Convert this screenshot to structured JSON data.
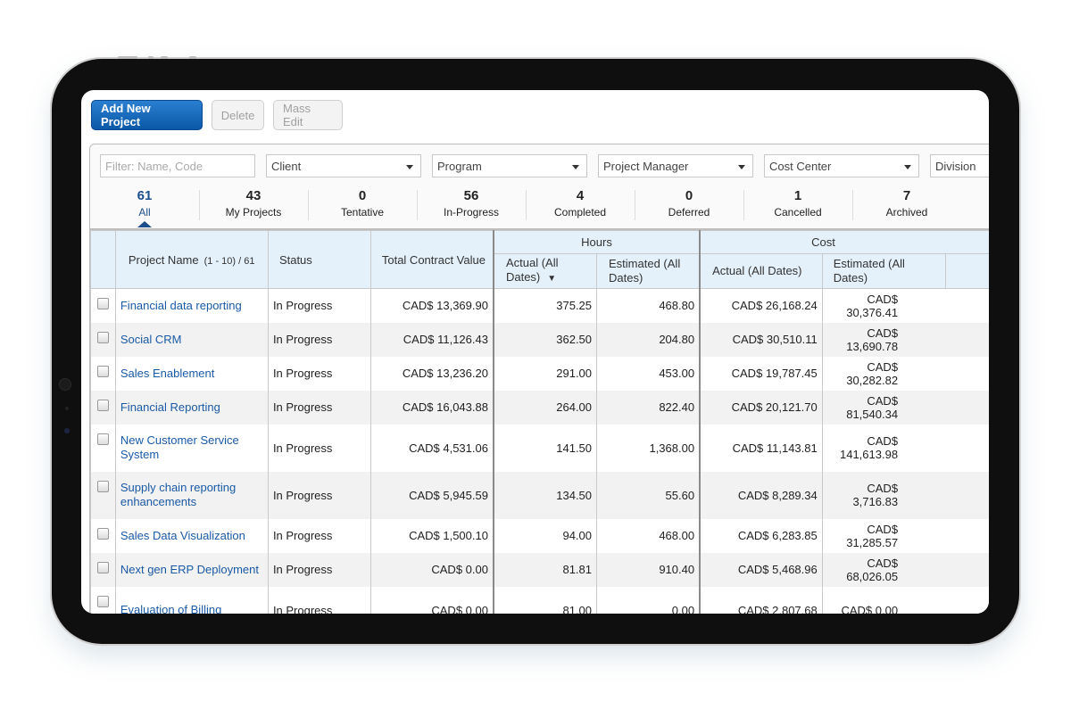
{
  "toolbar": {
    "add_label": "Add New Project",
    "delete_label": "Delete",
    "mass_edit_label": "Mass Edit"
  },
  "filters": {
    "search_placeholder": "Filter: Name, Code",
    "client": "Client",
    "program": "Program",
    "project_manager": "Project Manager",
    "cost_center": "Cost Center",
    "division": "Division"
  },
  "tabs": [
    {
      "count": "61",
      "label": "All",
      "active": true
    },
    {
      "count": "43",
      "label": "My Projects"
    },
    {
      "count": "0",
      "label": "Tentative"
    },
    {
      "count": "56",
      "label": "In-Progress"
    },
    {
      "count": "4",
      "label": "Completed"
    },
    {
      "count": "0",
      "label": "Deferred"
    },
    {
      "count": "1",
      "label": "Cancelled"
    },
    {
      "count": "7",
      "label": "Archived"
    }
  ],
  "table": {
    "headers": {
      "project_name": "Project Name",
      "pager": "(1 - 10) / 61",
      "status": "Status",
      "total_contract_value": "Total Contract Value",
      "hours_group": "Hours",
      "cost_group": "Cost",
      "hours_actual": "Actual (All Dates)",
      "hours_estimated": "Estimated (All Dates)",
      "cost_actual": "Actual (All Dates)",
      "cost_estimated": "Estimated (All Dates)",
      "sort_indicator": "▼"
    },
    "rows": [
      {
        "name": "Financial data reporting",
        "status": "In Progress",
        "tcv": "CAD$ 13,369.90",
        "h_act": "375.25",
        "h_est": "468.80",
        "c_act": "CAD$ 26,168.24",
        "c_est": "CAD$ 30,376.41"
      },
      {
        "name": "Social CRM",
        "status": "In Progress",
        "tcv": "CAD$ 11,126.43",
        "h_act": "362.50",
        "h_est": "204.80",
        "c_act": "CAD$ 30,510.11",
        "c_est": "CAD$ 13,690.78"
      },
      {
        "name": "Sales Enablement",
        "status": "In Progress",
        "tcv": "CAD$ 13,236.20",
        "h_act": "291.00",
        "h_est": "453.00",
        "c_act": "CAD$ 19,787.45",
        "c_est": "CAD$ 30,282.82"
      },
      {
        "name": "Financial Reporting",
        "status": "In Progress",
        "tcv": "CAD$ 16,043.88",
        "h_act": "264.00",
        "h_est": "822.40",
        "c_act": "CAD$ 20,121.70",
        "c_est": "CAD$ 81,540.34"
      },
      {
        "name": "New Customer Service System",
        "status": "In Progress",
        "tcv": "CAD$ 4,531.06",
        "h_act": "141.50",
        "h_est": "1,368.00",
        "c_act": "CAD$ 11,143.81",
        "c_est": "CAD$ 141,613.98"
      },
      {
        "name": "Supply chain reporting enhancements",
        "status": "In Progress",
        "tcv": "CAD$ 5,945.59",
        "h_act": "134.50",
        "h_est": "55.60",
        "c_act": "CAD$ 8,289.34",
        "c_est": "CAD$ 3,716.83"
      },
      {
        "name": "Sales Data Visualization",
        "status": "In Progress",
        "tcv": "CAD$ 1,500.10",
        "h_act": "94.00",
        "h_est": "468.00",
        "c_act": "CAD$ 6,283.85",
        "c_est": "CAD$ 31,285.57"
      },
      {
        "name": "Next gen ERP Deployment",
        "status": "In Progress",
        "tcv": "CAD$ 0.00",
        "h_act": "81.81",
        "h_est": "910.40",
        "c_act": "CAD$ 5,468.96",
        "c_est": "CAD$ 68,026.05"
      },
      {
        "name": "Evaluation of Billing",
        "status": "In Progress",
        "tcv": "CAD$ 0.00",
        "h_act": "81.00",
        "h_est": "0.00",
        "c_act": "CAD$ 2,807.68",
        "c_est": "CAD$ 0.00"
      }
    ]
  }
}
